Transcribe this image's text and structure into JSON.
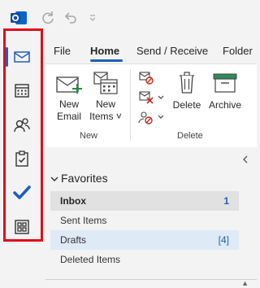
{
  "titlebar": {
    "app_icon": "outlook-logo-icon",
    "sync_icon": "sync-icon",
    "undo_icon": "undo-icon",
    "customize_icon": "customize-quick-access-icon"
  },
  "nav": {
    "items": [
      {
        "name": "mail",
        "icon": "mail-icon",
        "active": true
      },
      {
        "name": "calendar",
        "icon": "calendar-icon"
      },
      {
        "name": "people",
        "icon": "people-icon"
      },
      {
        "name": "tasks",
        "icon": "clipboard-check-icon"
      },
      {
        "name": "todo",
        "icon": "todo-check-icon"
      },
      {
        "name": "apps",
        "icon": "apps-grid-icon"
      }
    ],
    "highlight_color": "#e00d1a",
    "accent_color": "#1f5fb8"
  },
  "tabs": [
    {
      "label": "File"
    },
    {
      "label": "Home",
      "active": true
    },
    {
      "label": "Send / Receive"
    },
    {
      "label": "Folder"
    }
  ],
  "ribbon": {
    "new_email": {
      "line1": "New",
      "line2": "Email"
    },
    "new_items": {
      "line1": "New",
      "line2": "Items ˅"
    },
    "group_new": "New",
    "delete_label": "Delete",
    "archive_label": "Archive",
    "group_delete": "Delete"
  },
  "folders": {
    "favorites_label": "Favorites",
    "items": [
      {
        "label": "Inbox",
        "count": "1",
        "selected": true
      },
      {
        "label": "Sent Items",
        "count": ""
      },
      {
        "label": "Drafts",
        "count": "[4]",
        "highlighted": true
      },
      {
        "label": "Deleted Items",
        "count": ""
      }
    ]
  }
}
